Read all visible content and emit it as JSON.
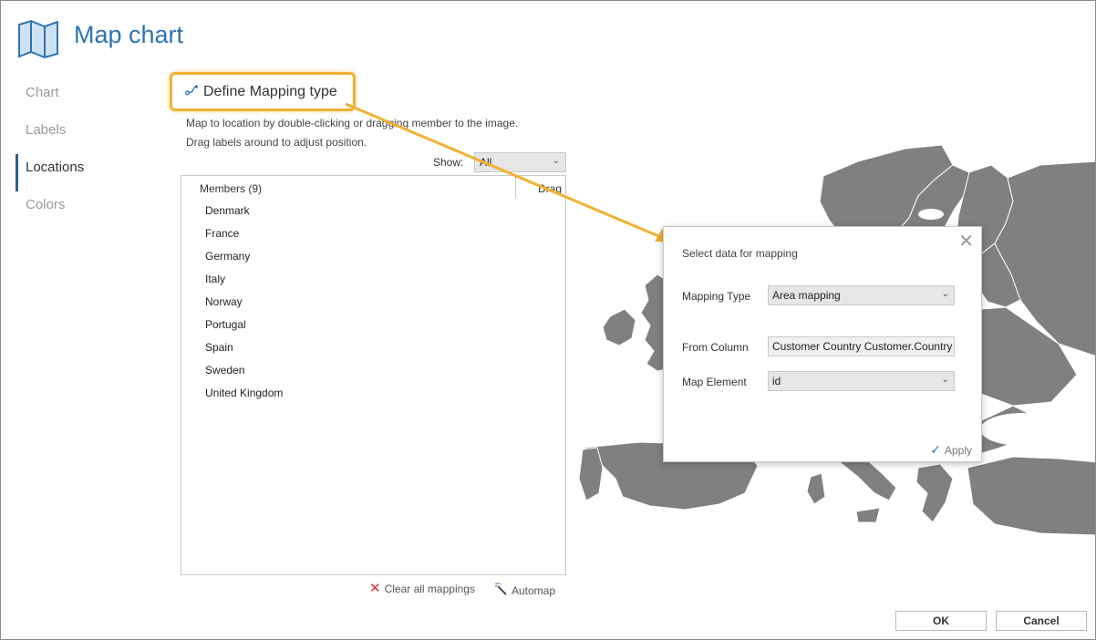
{
  "header": {
    "title": "Map chart",
    "icon": "map-icon"
  },
  "nav": {
    "items": [
      {
        "label": "Chart",
        "active": false
      },
      {
        "label": "Labels",
        "active": false
      },
      {
        "label": "Locations",
        "active": true
      },
      {
        "label": "Colors",
        "active": false
      }
    ]
  },
  "mapping": {
    "define_label": "Define Mapping type",
    "hint1": "Map to location by double-clicking or dragging member to the image.",
    "hint2": "Drag labels around to adjust position.",
    "show_label": "Show:",
    "show_value": "All"
  },
  "members": {
    "header": "Members (9)",
    "drag_header": "Drag",
    "items": [
      "Denmark",
      "France",
      "Germany",
      "Italy",
      "Norway",
      "Portugal",
      "Spain",
      "Sweden",
      "United Kingdom"
    ]
  },
  "actions": {
    "clear_label": "Clear all mappings",
    "automap_label": "Automap"
  },
  "dialog": {
    "title": "Select data for mapping",
    "mapping_type_label": "Mapping Type",
    "mapping_type_value": "Area mapping",
    "from_column_label": "From Column",
    "from_column_value": "Customer Country Customer.Country",
    "map_element_label": "Map Element",
    "map_element_value": "id",
    "apply_label": "Apply"
  },
  "footer": {
    "ok_label": "OK",
    "cancel_label": "Cancel"
  },
  "colors": {
    "accent": "#2e74b5",
    "highlight": "#f0b232",
    "map_fill": "#808080"
  }
}
